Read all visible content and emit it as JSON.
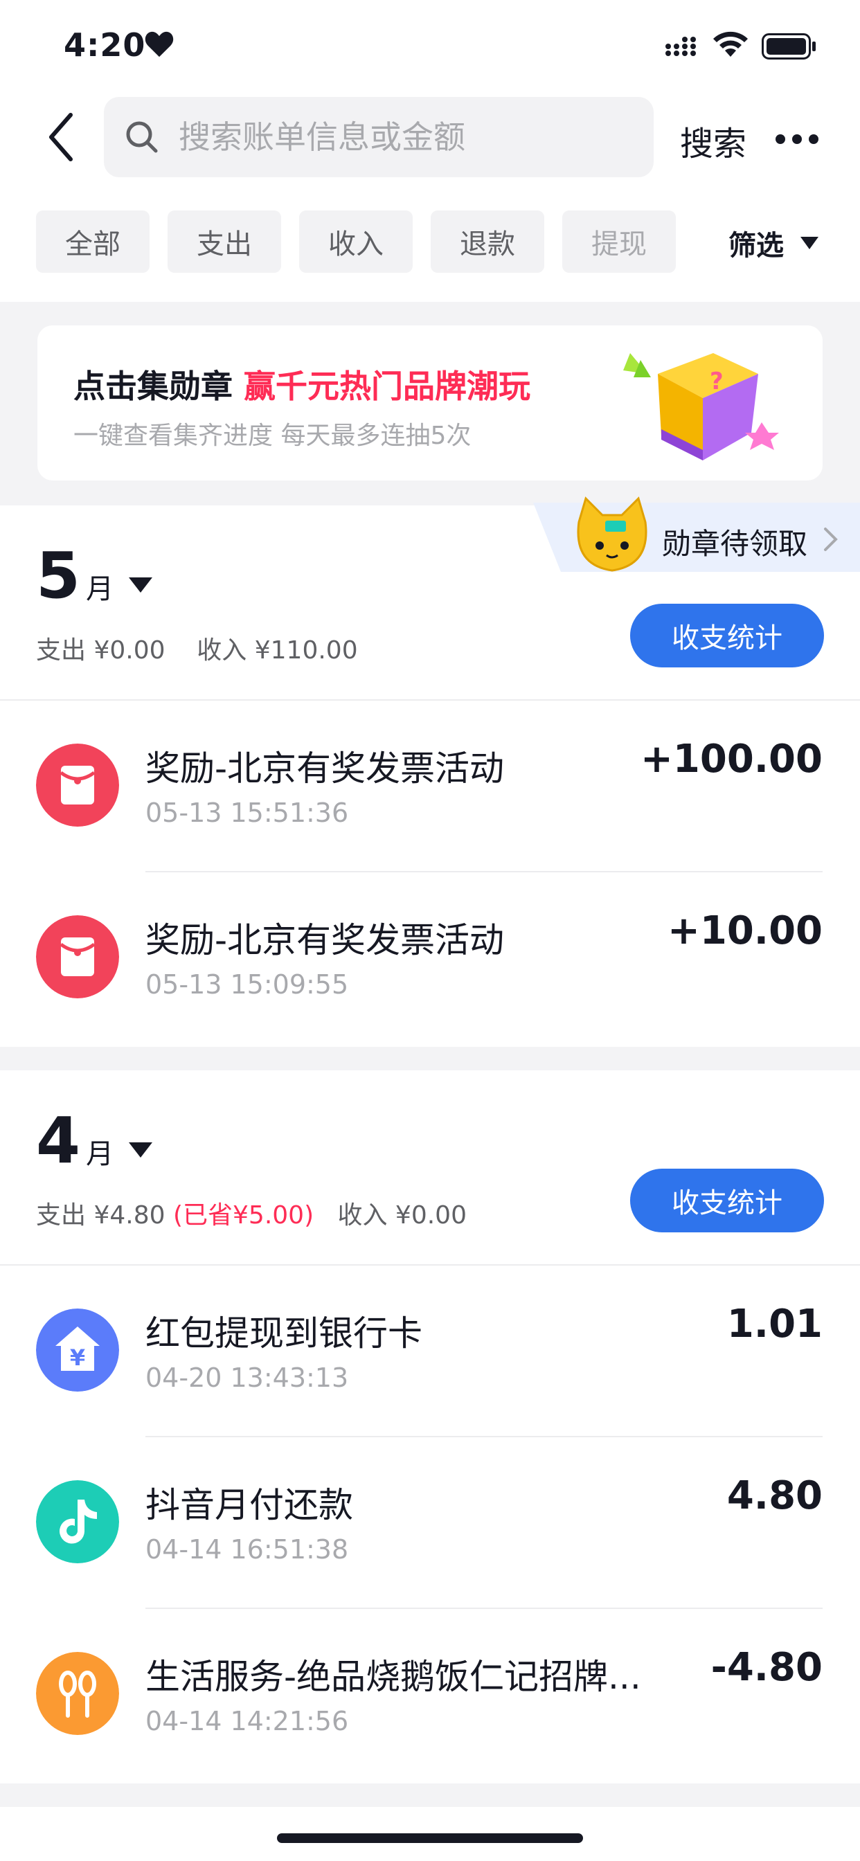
{
  "status_bar": {
    "time": "4:20"
  },
  "search": {
    "placeholder": "搜索账单信息或金额",
    "button": "搜索"
  },
  "tabs": [
    "全部",
    "支出",
    "收入",
    "退款",
    "提现"
  ],
  "filter": {
    "label": "筛选"
  },
  "banner": {
    "title": "点击集勋章 ",
    "title_highlight": "赢千元热门品牌潮玩",
    "subtitle": "一键查看集齐进度 每天最多连抽5次"
  },
  "badge_pending": "勋章待领取",
  "months": [
    {
      "number": "5",
      "suffix": "月",
      "summary_expense": "支出 ¥0.00",
      "summary_saved": "",
      "summary_income": "收入 ¥110.00",
      "stat_button": "收支统计",
      "transactions": [
        {
          "title": "奖励-北京有奖发票活动",
          "time": "05-13 15:51:36",
          "amount": "+100.00",
          "icon": "red-envelope-icon"
        },
        {
          "title": "奖励-北京有奖发票活动",
          "time": "05-13 15:09:55",
          "amount": "+10.00",
          "icon": "red-envelope-icon"
        }
      ]
    },
    {
      "number": "4",
      "suffix": "月",
      "summary_expense": "支出 ¥4.80",
      "summary_saved": "(已省¥5.00)",
      "summary_income": "收入 ¥0.00",
      "stat_button": "收支统计",
      "transactions": [
        {
          "title": "红包提现到银行卡",
          "time": "04-20 13:43:13",
          "amount": "1.01",
          "icon": "bank-yuan-icon"
        },
        {
          "title": "抖音月付还款",
          "time": "04-14 16:51:38",
          "amount": "4.80",
          "icon": "douyin-logo-icon"
        },
        {
          "title": "生活服务-绝品烧鹅饭仁记招牌...",
          "time": "04-14 14:21:56",
          "amount": "-4.80",
          "icon": "fork-knife-icon"
        }
      ]
    }
  ],
  "colors": {
    "accent_blue": "#2f74ec",
    "highlight_red": "#fe2c55",
    "icon_red": "#f2435a",
    "icon_blue": "#5b7cfa",
    "icon_teal": "#1dcdb6",
    "icon_orange": "#fb9a32"
  }
}
